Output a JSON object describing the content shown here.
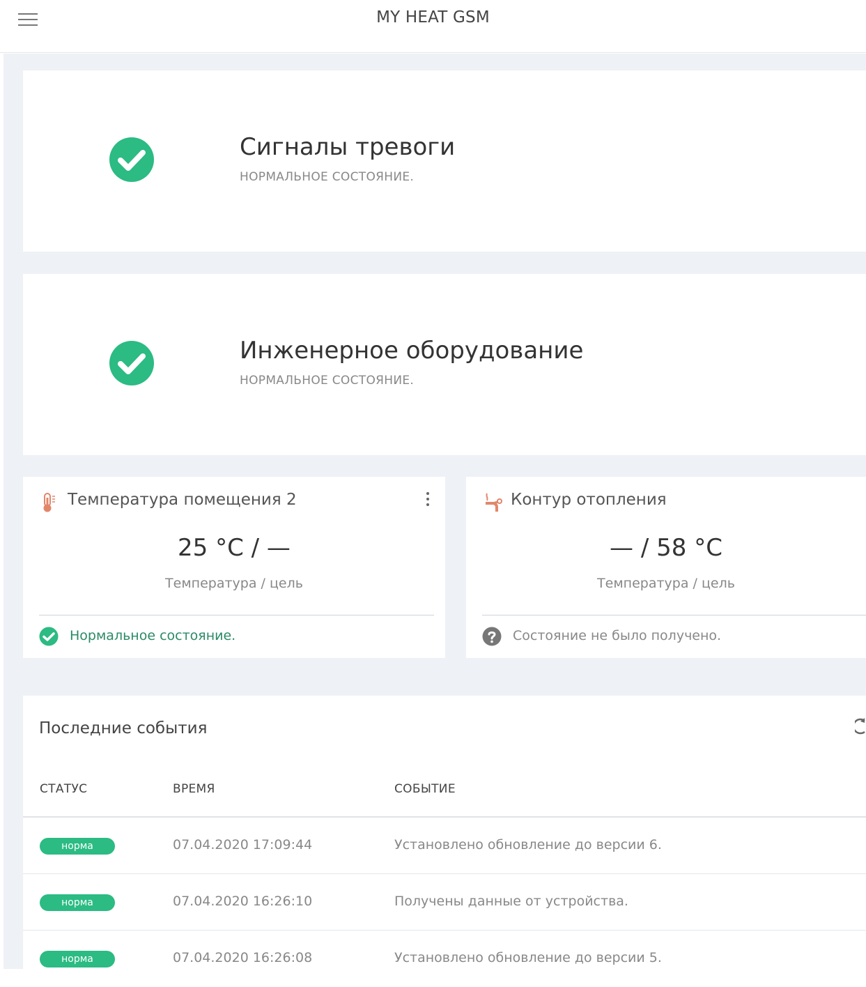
{
  "app": {
    "title": "MY HEAT GSM"
  },
  "alarm_card": {
    "title": "Сигналы тревоги",
    "status": "НОРМАЛЬНОЕ СОСТОЯНИЕ."
  },
  "equipment_card": {
    "title": "Инженерное оборудование",
    "status": "НОРМАЛЬНОЕ СОСТОЯНИЕ."
  },
  "room_widget": {
    "title": "Температура помещения 2",
    "value": "25 °C / —",
    "caption": "Температура / цель",
    "status": "Нормальное состояние.",
    "status_color": "#2a8a66"
  },
  "heating_widget": {
    "title": "Контур отопления",
    "value": "— / 58 °C",
    "caption": "Температура / цель",
    "status": "Состояние не было получено.",
    "status_color": "#888888"
  },
  "events": {
    "title": "Последние события",
    "columns": {
      "status": "СТАТУС",
      "time": "ВРЕМЯ",
      "event": "СОБЫТИЕ"
    },
    "rows": [
      {
        "status": "норма",
        "time": "07.04.2020 17:09:44",
        "event": "Установлено обновление до версии 6."
      },
      {
        "status": "норма",
        "time": "07.04.2020 16:26:10",
        "event": "Получены данные от устройства."
      },
      {
        "status": "норма",
        "time": "07.04.2020 16:26:08",
        "event": "Установлено обновление до версии 5."
      }
    ]
  },
  "colors": {
    "ok_green": "#2bbb83",
    "background": "#eef1f5"
  }
}
